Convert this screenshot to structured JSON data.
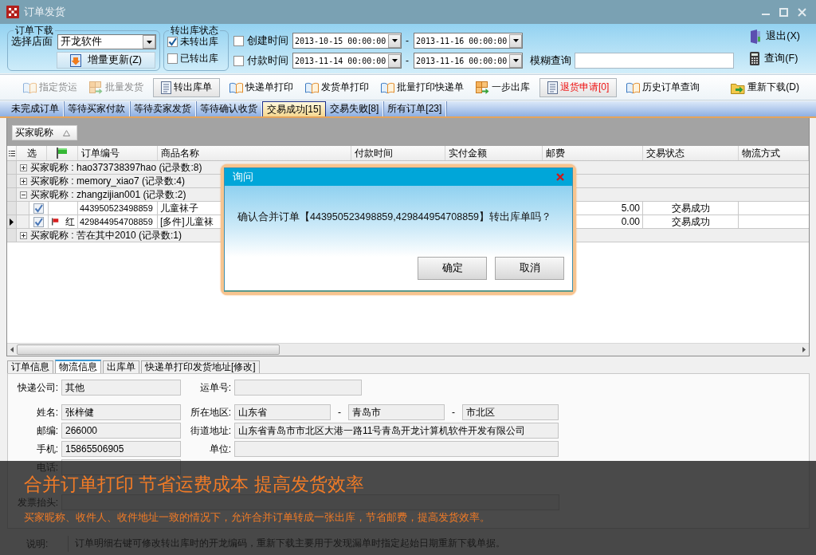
{
  "window": {
    "title": "订单发货"
  },
  "download": {
    "legend": "订单下载",
    "store_label": "选择店面",
    "store": "开龙软件",
    "update_button": "增量更新(Z)"
  },
  "transfer_status": {
    "legend": "转出库状态",
    "options": [
      {
        "label": "未转出库",
        "checked": true
      },
      {
        "label": "已转出库",
        "checked": false
      }
    ]
  },
  "date_filters": [
    {
      "label": "创建时间",
      "checked": false,
      "from": "2013-10-15 00:00:00",
      "separator": "-",
      "to": "2013-11-16 00:00:00"
    },
    {
      "label": "付款时间",
      "checked": false,
      "from": "2013-11-14 00:00:00",
      "separator": "-",
      "to": "2013-11-16 00:00:00"
    }
  ],
  "fuzzy_search": {
    "label": "模糊查询"
  },
  "side_buttons": [
    {
      "kind": "exit",
      "label": "退出(X)"
    },
    {
      "kind": "query",
      "label": "查询(F)"
    }
  ],
  "toolbar": [
    {
      "kind": "print",
      "label": "指定货运",
      "disabled": true,
      "alert": false
    },
    {
      "kind": "ship",
      "label": "批量发货",
      "disabled": true,
      "alert": false
    },
    {
      "kind": "form",
      "label": "转出库单",
      "disabled": false,
      "alert": false
    },
    {
      "kind": "print",
      "label": "快递单打印",
      "disabled": false,
      "alert": false
    },
    {
      "kind": "print",
      "label": "发货单打印",
      "disabled": false,
      "alert": false
    },
    {
      "kind": "print",
      "label": "批量打印快递单",
      "disabled": false,
      "alert": false
    },
    {
      "kind": "ship",
      "label": "一步出库",
      "disabled": false,
      "alert": false
    },
    {
      "kind": "form",
      "label": "退货申请[0]",
      "disabled": false,
      "alert": true
    },
    {
      "kind": "print",
      "label": "历史订单查询",
      "disabled": false,
      "alert": false
    },
    {
      "kind": "reload",
      "label": "重新下载(D)",
      "disabled": false,
      "alert": false
    }
  ],
  "tabs": [
    {
      "label": "未完成订单",
      "selected": false
    },
    {
      "label": "等待买家付款",
      "selected": false
    },
    {
      "label": "等待卖家发货",
      "selected": false
    },
    {
      "label": "等待确认收货",
      "selected": false
    },
    {
      "label": "交易成功[15]",
      "selected": true
    },
    {
      "label": "交易失败[8]",
      "selected": false
    },
    {
      "label": "所有订单[23]",
      "selected": false
    }
  ],
  "grid": {
    "group_by": "买家昵称",
    "columns": [
      {
        "kind": "check",
        "label": "选"
      },
      {
        "kind": "flag"
      },
      {
        "kind": "text",
        "label": "订单编号"
      },
      {
        "kind": "text",
        "label": "商品名称"
      },
      {
        "kind": "text",
        "label": "付款时间"
      },
      {
        "kind": "text",
        "label": "实付金额"
      },
      {
        "kind": "text",
        "label": "邮费"
      },
      {
        "kind": "text",
        "label": "交易状态"
      },
      {
        "kind": "text",
        "label": "物流方式"
      }
    ],
    "groups": [
      {
        "label": "买家昵称 : hao373738397hao (记录数:8)",
        "expanded": false
      },
      {
        "label": "买家昵称 : memory_xiao7 (记录数:4)",
        "expanded": false
      },
      {
        "label": "买家昵称 : zhangzijian001 (记录数:2)",
        "expanded": true,
        "children": [
          {
            "current": false,
            "checked": true,
            "flagged": false,
            "order_no": "443950523498859",
            "product": "儿童袜子",
            "postage": "5.00",
            "status": "交易成功"
          },
          {
            "current": true,
            "checked": true,
            "flagged": true,
            "flag_label": "红",
            "order_no": "429844954708859",
            "product": "[多件]儿童袜",
            "postage": "0.00",
            "status": "交易成功"
          }
        ]
      },
      {
        "label": "买家昵称 : 苦在其中2010 (记录数:1)",
        "expanded": false
      }
    ]
  },
  "details": {
    "tabs": [
      {
        "label": "订单信息",
        "selected": false
      },
      {
        "label": "物流信息",
        "selected": true
      },
      {
        "label": "出库单",
        "selected": false
      },
      {
        "label": "快递单打印发货地址[修改]",
        "selected": false
      }
    ],
    "rows": [
      [
        {
          "kind": "field",
          "label": "快递公司:",
          "value": "其他"
        },
        {
          "kind": "field",
          "label": "运单号:"
        }
      ],
      [
        {
          "kind": "field",
          "label": "姓名:",
          "value": "张梓健"
        },
        {
          "kind": "region",
          "label": "所在地区:",
          "values": [
            "山东省",
            "青岛市",
            "市北区"
          ],
          "separators": [
            "-",
            "-"
          ]
        }
      ],
      [
        {
          "kind": "field",
          "label": "邮编:",
          "value": "266000"
        },
        {
          "kind": "wide",
          "label": "街道地址:",
          "value": "山东省青岛市市北区大港一路11号青岛开龙计算机软件开发有限公司"
        }
      ],
      [
        {
          "kind": "field",
          "label": "手机:",
          "value": "15865506905"
        },
        {
          "kind": "wide",
          "label": "单位:"
        }
      ],
      [
        {
          "kind": "field",
          "label": "电话:"
        }
      ],
      [
        {
          "kind": "full",
          "label": "发票抬头:"
        }
      ]
    ]
  },
  "status_bar": {
    "label": "说明:",
    "text": "订单明细右键可修改转出库时的开龙编码，重新下载主要用于发现漏单时指定起始日期重新下载单据。"
  },
  "banner": {
    "title": "合并订单打印 节省运费成本 提高发货效率",
    "text": "买家昵称、收件人、收件地址一致的情况下，允许合并订单转成一张出库，节省邮费，提高发货效率。"
  },
  "dialog": {
    "title": "询问",
    "message": "确认合并订单【443950523498859,429844954708859】转出库单吗？",
    "buttons": [
      "确定",
      "取消"
    ]
  }
}
